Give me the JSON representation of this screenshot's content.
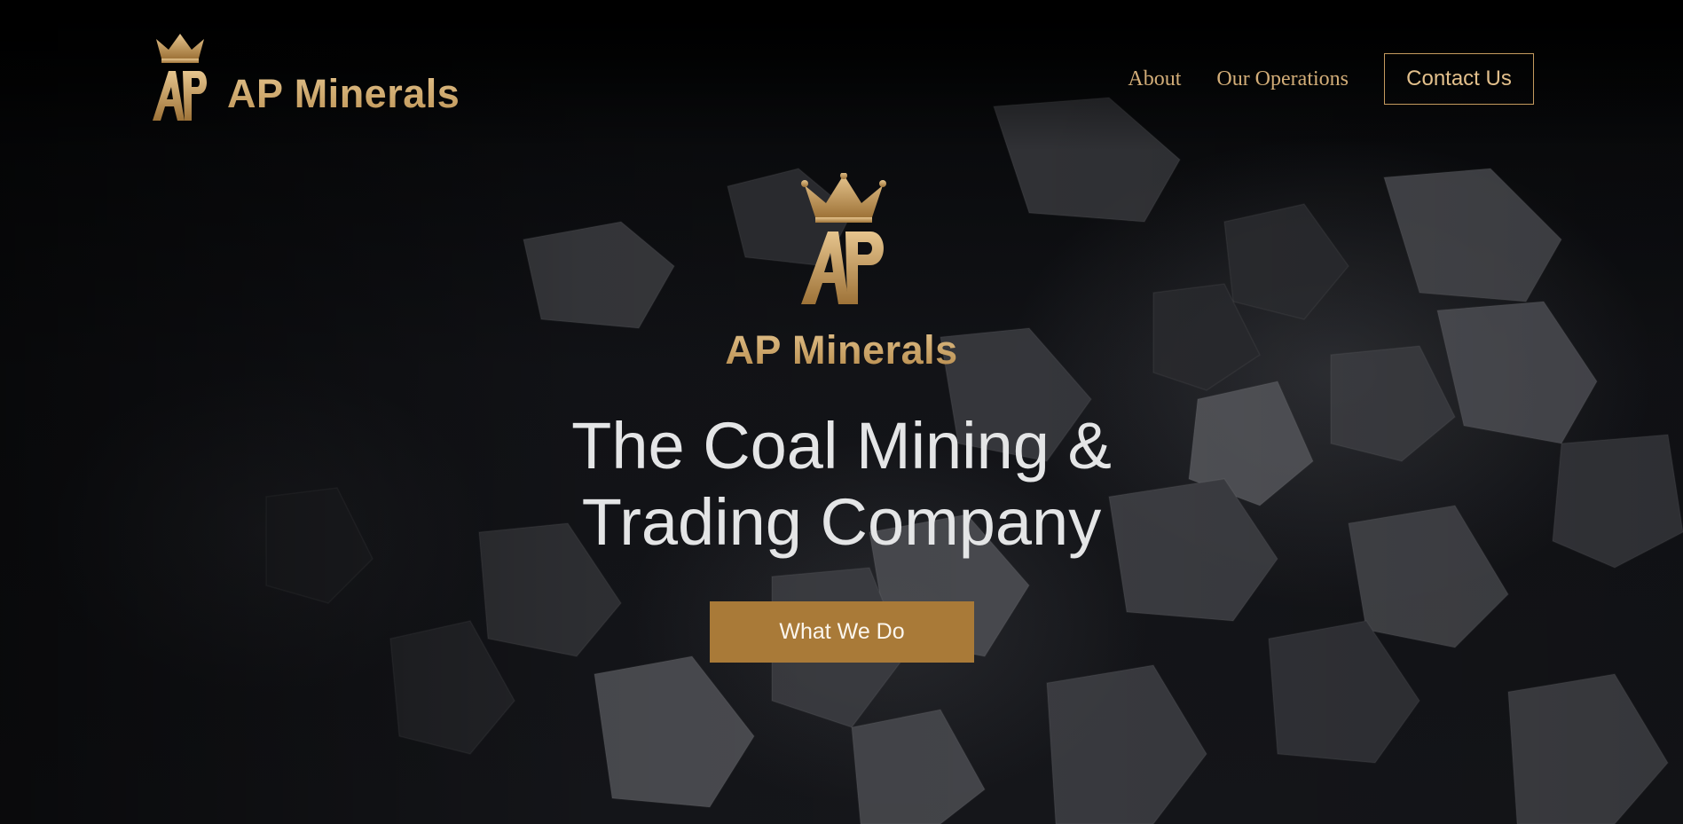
{
  "header": {
    "brand_name": "AP Minerals",
    "logo_icon": "crown-ap-monogram-icon",
    "nav": [
      {
        "label": "About"
      },
      {
        "label": "Our Operations"
      }
    ],
    "contact_label": "Contact Us"
  },
  "hero": {
    "logo_icon": "crown-ap-monogram-icon",
    "brand_name": "AP Minerals",
    "title_line1": "The Coal Mining &",
    "title_line2": "Trading Company",
    "cta_label": "What We Do",
    "background": "coal-rocks-photo"
  },
  "colors": {
    "gold": "#c9a36a",
    "cta": "#a97a38",
    "title": "#e4e5e6",
    "background": "#0d0e11"
  }
}
